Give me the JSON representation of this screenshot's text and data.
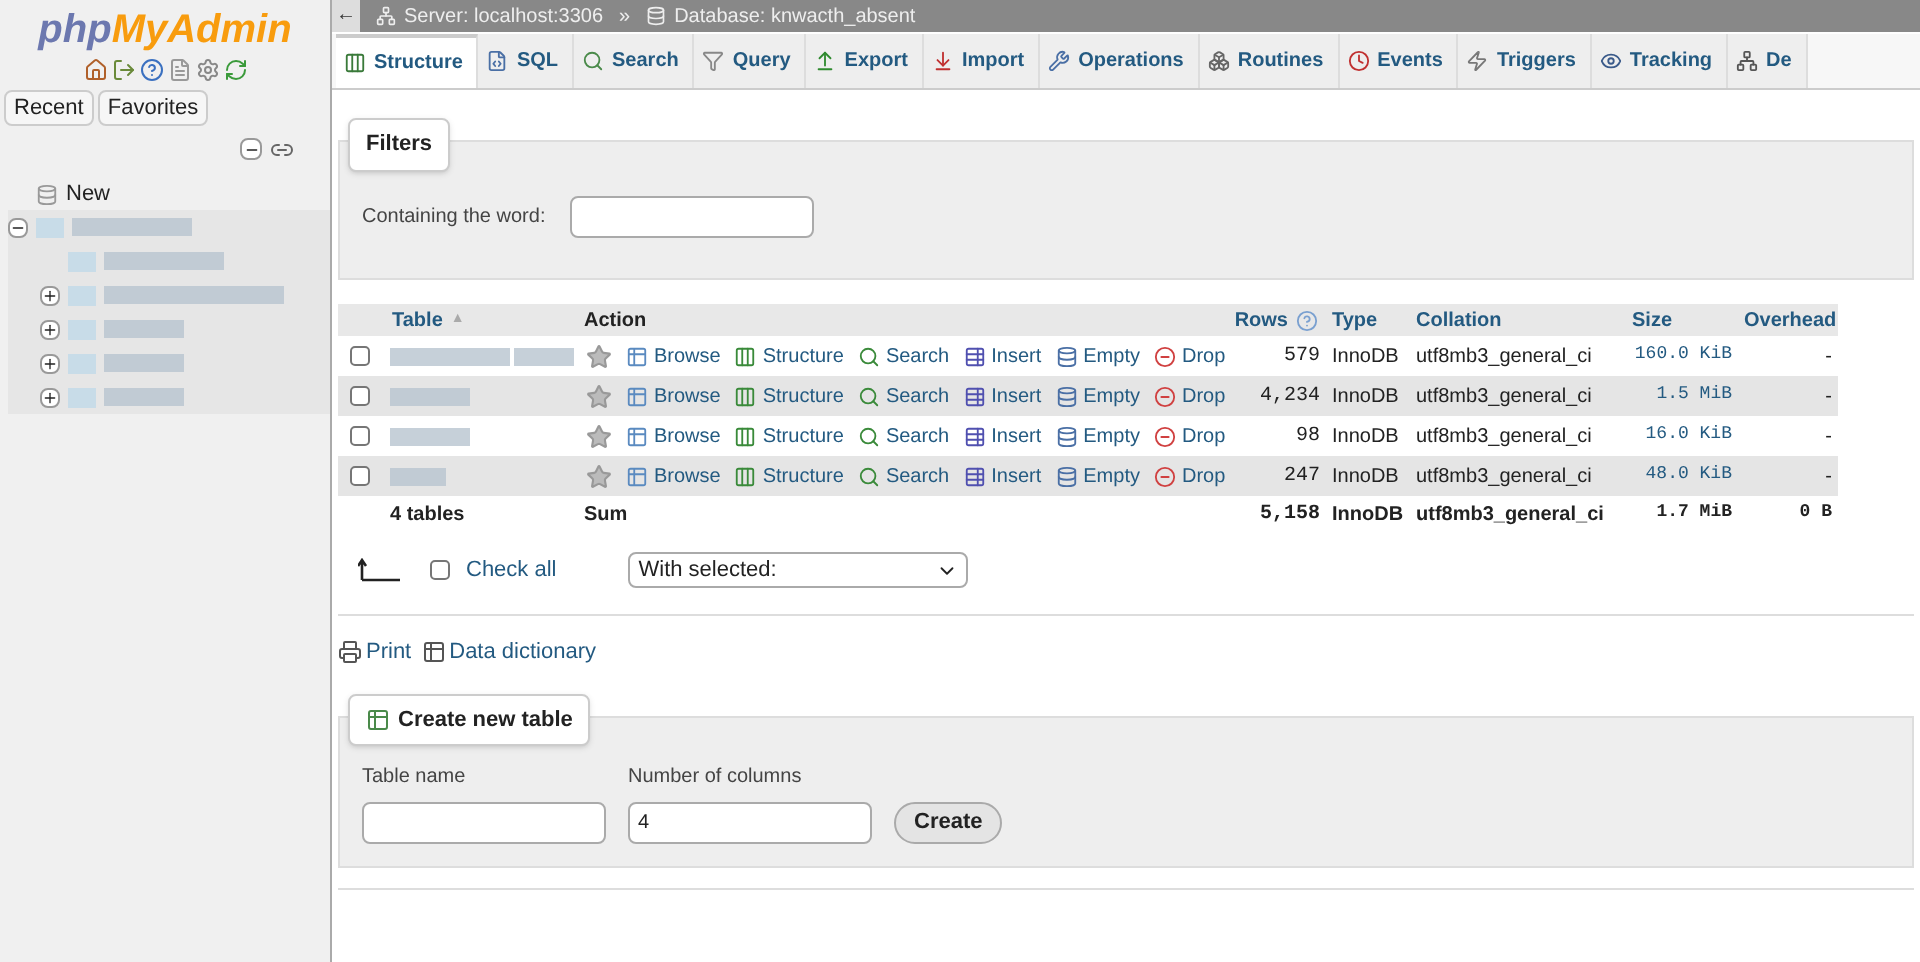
{
  "sidebar": {
    "logo_left": "php",
    "logo_right": "MyAdmin",
    "tabs": [
      {
        "label": "Recent"
      },
      {
        "label": "Favorites"
      }
    ],
    "new_label": "New",
    "tree": [
      {
        "expanded": true,
        "children": [
          {
            "kind": "leaf"
          },
          {
            "kind": "node",
            "expanded": false
          },
          {
            "kind": "node",
            "expanded": false
          },
          {
            "kind": "node",
            "expanded": false
          },
          {
            "kind": "node",
            "expanded": false
          }
        ]
      }
    ]
  },
  "breadcrumb": {
    "back": "←",
    "items": [
      "Server: localhost:3306",
      "Database: knwacth_absent"
    ],
    "separator": "»"
  },
  "tabs": [
    {
      "label": "Structure",
      "selected": true
    },
    {
      "label": "SQL",
      "selected": false
    },
    {
      "label": "Search",
      "selected": false
    },
    {
      "label": "Query",
      "selected": false
    },
    {
      "label": "Export",
      "selected": false
    },
    {
      "label": "Import",
      "selected": false
    },
    {
      "label": "Operations",
      "selected": false
    },
    {
      "label": "Routines",
      "selected": false
    },
    {
      "label": "Events",
      "selected": false
    },
    {
      "label": "Triggers",
      "selected": false
    },
    {
      "label": "Tracking",
      "selected": false
    },
    {
      "label": "De",
      "selected": false
    }
  ],
  "filters": {
    "legend": "Filters",
    "label": "Containing the word:"
  },
  "table": {
    "columns": [
      "Table",
      "Action",
      "Rows",
      "Type",
      "Collation",
      "Size",
      "Overhead"
    ],
    "sort_indicator": "▲",
    "rows": [
      {
        "checked": false,
        "favorite": false,
        "actions": [
          "Browse",
          "Structure",
          "Search",
          "Insert",
          "Empty",
          "Drop"
        ],
        "rows": "579",
        "type": "InnoDB",
        "collation": "utf8mb3_general_ci",
        "size": "160.0 KiB",
        "overhead": "-"
      },
      {
        "checked": false,
        "favorite": false,
        "actions": [
          "Browse",
          "Structure",
          "Search",
          "Insert",
          "Empty",
          "Drop"
        ],
        "rows": "4,234",
        "type": "InnoDB",
        "collation": "utf8mb3_general_ci",
        "size": "1.5 MiB",
        "overhead": "-"
      },
      {
        "checked": false,
        "favorite": false,
        "actions": [
          "Browse",
          "Structure",
          "Search",
          "Insert",
          "Empty",
          "Drop"
        ],
        "rows": "98",
        "type": "InnoDB",
        "collation": "utf8mb3_general_ci",
        "size": "16.0 KiB",
        "overhead": "-"
      },
      {
        "checked": false,
        "favorite": false,
        "actions": [
          "Browse",
          "Structure",
          "Search",
          "Insert",
          "Empty",
          "Drop"
        ],
        "rows": "247",
        "type": "InnoDB",
        "collation": "utf8mb3_general_ci",
        "size": "48.0 KiB",
        "overhead": "-"
      }
    ],
    "footer": {
      "count": "4 tables",
      "label": "Sum",
      "rows": "5,158",
      "type": "InnoDB",
      "collation": "utf8mb3_general_ci",
      "size": "1.7 MiB",
      "overhead": "0 B"
    }
  },
  "bulk": {
    "check_all": "Check all",
    "checked": false,
    "select": "With selected:"
  },
  "links": [
    {
      "label": "Print"
    },
    {
      "label": "Data dictionary"
    }
  ],
  "create": {
    "legend": "Create new table",
    "name_label": "Table name",
    "columns_label": "Number of columns",
    "columns_value": "4",
    "button": "Create"
  }
}
